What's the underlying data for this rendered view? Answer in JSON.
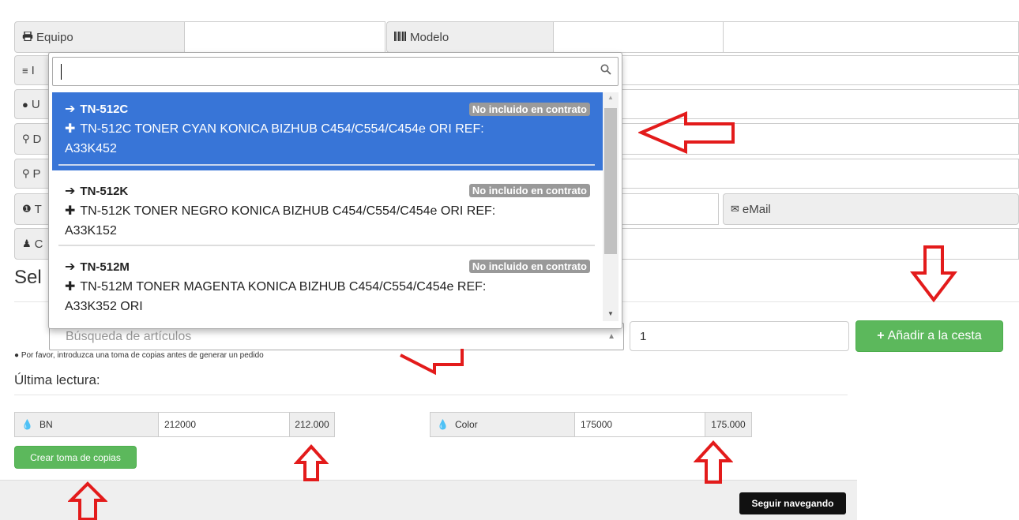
{
  "form": {
    "equipo_label": "Equipo",
    "modelo_label": "Modelo",
    "email_label": "eMail",
    "row_labels_partial": [
      "I",
      "U",
      "D",
      "P",
      "T",
      "C"
    ],
    "section_heading_partial": "Sel"
  },
  "dropdown": {
    "search_value": "",
    "results": [
      {
        "code": "TN-512C",
        "badge": "No incluido en contrato",
        "desc_line1": "TN-512C TONER CYAN KONICA BIZHUB C454/C554/C454e ORI REF:",
        "desc_line2": "A33K452",
        "active": true
      },
      {
        "code": "TN-512K",
        "badge": "No incluido en contrato",
        "desc_line1": "TN-512K TONER NEGRO KONICA BIZHUB C454/C554/C454e ORI REF:",
        "desc_line2": "A33K152",
        "active": false
      },
      {
        "code": "TN-512M",
        "badge": "No incluido en contrato",
        "desc_line1": "TN-512M TONER MAGENTA KONICA BIZHUB C454/C554/C454e REF:",
        "desc_line2": "A33K352 ORI",
        "active": false
      }
    ]
  },
  "article_search": {
    "placeholder": "Búsqueda de artículos",
    "quantity": "1",
    "add_button": "Añadir a la cesta",
    "notice": "Por favor, introduzca una toma de copias antes de generar un pedido"
  },
  "lectura": {
    "title": "Última lectura:",
    "bn_label": "BN",
    "bn_value": "212000",
    "bn_formatted": "212.000",
    "color_label": "Color",
    "color_value": "175000",
    "color_formatted": "175.000",
    "create_button": "Crear toma de copias"
  },
  "footer": {
    "continue_button": "Seguir navegando"
  },
  "colors": {
    "accent_red": "#e31b1b",
    "highlight_blue": "#3875d7",
    "success_green": "#5cb85c"
  }
}
